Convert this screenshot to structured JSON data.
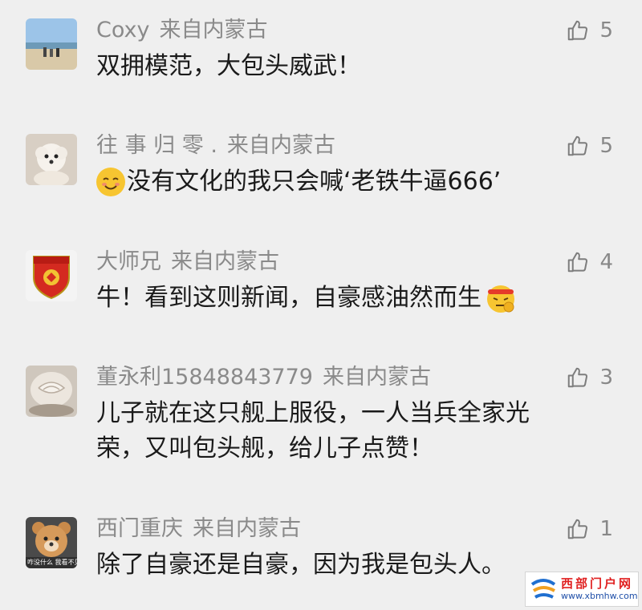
{
  "comments": [
    {
      "name": "Coxy",
      "location": "来自内蒙古",
      "likes": "5",
      "body": "双拥模范，大包头威武！",
      "avatar": "beach-photo-avatar"
    },
    {
      "name": "往 事 归 零 .",
      "location": "来自内蒙古",
      "likes": "5",
      "body": "没有文化的我只会喊‘老铁牛逼666’",
      "avatar": "white-dog-avatar",
      "emoji": "blushing-smile-emoji"
    },
    {
      "name": "大师兄",
      "location": "来自内蒙古",
      "likes": "4",
      "body": "牛！看到这则新闻，自豪感油然而生",
      "avatar": "football-club-crest-avatar",
      "emoji": "headband-salute-emoji"
    },
    {
      "name": "董永利15848843779",
      "location": "来自内蒙古",
      "likes": "3",
      "body_line1": "儿子就在这只舰上服役，一人当兵全家光",
      "body_line2": "荣，又叫包头舰，给儿子点赞！",
      "avatar": "pastry-avatar"
    },
    {
      "name": "西门重庆",
      "location": "来自内蒙古",
      "likes": "1",
      "body": "除了自豪还是自豪，因为我是包头人。",
      "avatar": "bear-avatar",
      "avatar_caption": "咋没什么 我看不见"
    }
  ],
  "watermark": {
    "title": "西部门户网",
    "url": "www.xbmhw.com"
  },
  "colors": {
    "background": "#efefef",
    "meta_text": "#8a8a8a",
    "body_text": "#1a1a1a",
    "watermark_red": "#e02020",
    "watermark_blue": "#1f4fa8"
  }
}
